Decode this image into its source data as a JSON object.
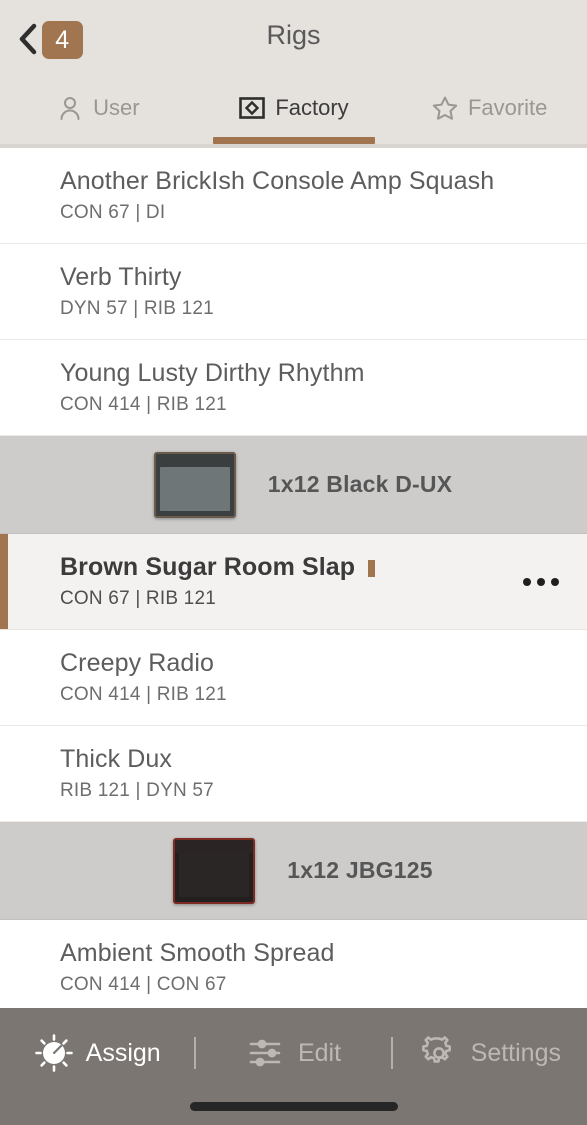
{
  "header": {
    "back_icon": "chevron-left-icon",
    "badge": "4",
    "title": "Rigs"
  },
  "tabs": [
    {
      "label": "User",
      "icon": "user-icon",
      "active": false
    },
    {
      "label": "Factory",
      "icon": "diamond-square-icon",
      "active": true
    },
    {
      "label": "Favorite",
      "icon": "star-icon",
      "active": false
    }
  ],
  "colors": {
    "accent": "#a1754f",
    "header_bg": "#e5e1dd",
    "group_bg": "#cdcccb",
    "selected_bg": "#f4f2f0",
    "bottombar_bg": "#7b7671"
  },
  "list": [
    {
      "type": "rig",
      "title": "Another BrickIsh Console Amp Squash",
      "subtitle": "CON 67 | DI",
      "selected": false
    },
    {
      "type": "rig",
      "title": "Verb Thirty",
      "subtitle": "DYN 57 | RIB 121",
      "selected": false
    },
    {
      "type": "rig",
      "title": "Young Lusty Dirthy Rhythm",
      "subtitle": "CON 414 | RIB 121",
      "selected": false
    },
    {
      "type": "group",
      "title": "1x12 Black D-UX",
      "thumb": "cabinet-black-icon"
    },
    {
      "type": "rig",
      "title": "Brown Sugar Room Slap",
      "subtitle": "CON 67 | RIB 121",
      "selected": true,
      "more_icon": "more-horizontal-icon"
    },
    {
      "type": "rig",
      "title": "Creepy Radio",
      "subtitle": "CON 414 | RIB 121",
      "selected": false
    },
    {
      "type": "rig",
      "title": "Thick Dux",
      "subtitle": "RIB 121 | DYN 57",
      "selected": false
    },
    {
      "type": "group",
      "title": "1x12 JBG125",
      "thumb": "cabinet-red-icon"
    },
    {
      "type": "rig",
      "title": "Ambient Smooth Spread",
      "subtitle": "CON 414 | CON 67",
      "selected": false
    }
  ],
  "bottombar": {
    "items": [
      {
        "label": "Assign",
        "icon": "knob-icon",
        "active": true
      },
      {
        "label": "Edit",
        "icon": "sliders-icon",
        "active": false
      },
      {
        "label": "Settings",
        "icon": "gear-icon",
        "active": false
      }
    ],
    "separator": "|"
  }
}
